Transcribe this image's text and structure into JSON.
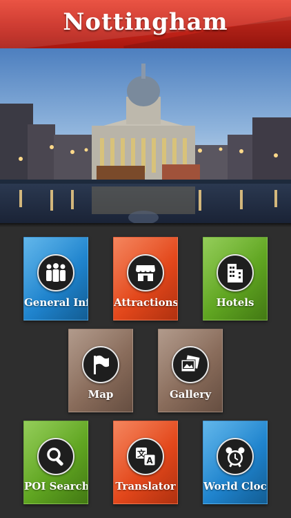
{
  "app": {
    "title": "Nottingham"
  },
  "hero": {
    "image": "nottingham-council-house-photo"
  },
  "tiles": [
    {
      "label": "General Info",
      "icon": "people-icon",
      "color": "#1e82cc"
    },
    {
      "label": "Attractions",
      "icon": "store-icon",
      "color": "#e2461a"
    },
    {
      "label": "Hotels",
      "icon": "building-icon",
      "color": "#5ea320"
    },
    {
      "label": "Map",
      "icon": "flag-icon",
      "color": "#876a59"
    },
    {
      "label": "Gallery",
      "icon": "photos-icon",
      "color": "#876a59"
    },
    {
      "label": "POI Search",
      "icon": "magnifier-icon",
      "color": "#5ea320"
    },
    {
      "label": "Translator",
      "icon": "translate-icon",
      "color": "#e2461a"
    },
    {
      "label": "World Clock",
      "icon": "alarm-clock-icon",
      "color": "#1e82cc"
    }
  ]
}
